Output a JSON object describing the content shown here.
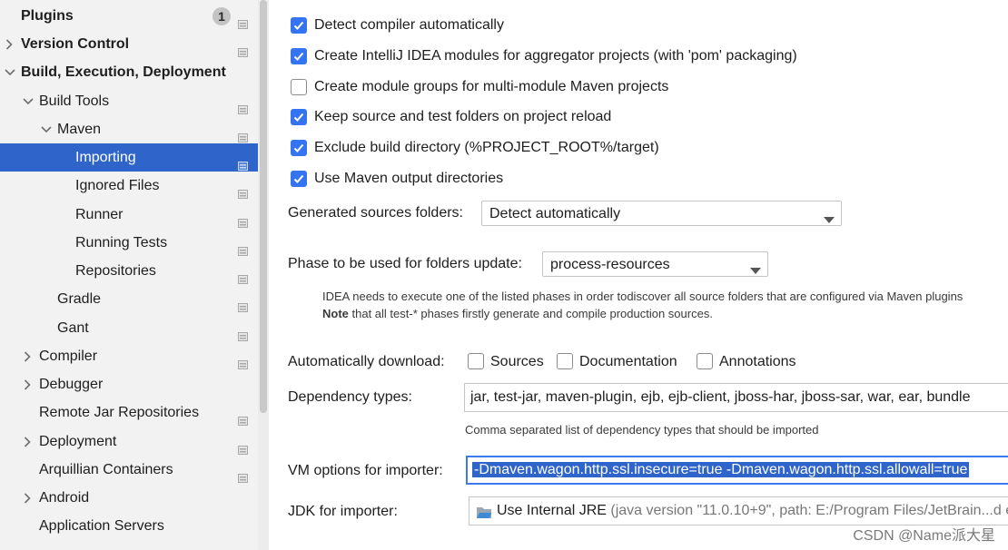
{
  "sidebar": {
    "items": [
      {
        "label": "Plugins",
        "badge": "1"
      },
      {
        "label": "Version Control"
      },
      {
        "label": "Build, Execution, Deployment"
      },
      {
        "label": "Build Tools"
      },
      {
        "label": "Maven"
      },
      {
        "label": "Importing"
      },
      {
        "label": "Ignored Files"
      },
      {
        "label": "Runner"
      },
      {
        "label": "Running Tests"
      },
      {
        "label": "Repositories"
      },
      {
        "label": "Gradle"
      },
      {
        "label": "Gant"
      },
      {
        "label": "Compiler"
      },
      {
        "label": "Debugger"
      },
      {
        "label": "Remote Jar Repositories"
      },
      {
        "label": "Deployment"
      },
      {
        "label": "Arquillian Containers"
      },
      {
        "label": "Android"
      },
      {
        "label": "Application Servers"
      }
    ]
  },
  "main": {
    "checkboxes": [
      {
        "label": "Detect compiler automatically",
        "checked": true
      },
      {
        "label": "Create IntelliJ IDEA modules for aggregator projects (with 'pom' packaging)",
        "checked": true
      },
      {
        "label": "Create module groups for multi-module Maven projects",
        "checked": false
      },
      {
        "label": "Keep source and test folders on project reload",
        "checked": true
      },
      {
        "label": "Exclude build directory (%PROJECT_ROOT%/target)",
        "checked": true
      },
      {
        "label": "Use Maven output directories",
        "checked": true
      }
    ],
    "generated_sources": {
      "label": "Generated sources folders:",
      "value": "Detect automatically"
    },
    "phase": {
      "label": "Phase to be used for folders update:",
      "value": "process-resources"
    },
    "phase_note": {
      "line1": "IDEA needs to execute one of the listed phases in order todiscover all source folders that are configured via Maven plugins",
      "note_bold": "Note",
      "line2_rest": " that all test-* phases firstly generate and compile production sources."
    },
    "auto_download": {
      "label": "Automatically download:",
      "options": [
        {
          "label": "Sources",
          "checked": false
        },
        {
          "label": "Documentation",
          "checked": false
        },
        {
          "label": "Annotations",
          "checked": false
        }
      ]
    },
    "dependency_types": {
      "label": "Dependency types:",
      "value": "jar, test-jar, maven-plugin, ejb, ejb-client, jboss-har, jboss-sar, war, ear, bundle",
      "hint": "Comma separated list of dependency types that should be imported"
    },
    "vm_options": {
      "label": "VM options for importer:",
      "value": "-Dmaven.wagon.http.ssl.insecure=true -Dmaven.wagon.http.ssl.allowall=true"
    },
    "jdk": {
      "label": "JDK for importer:",
      "value": "Use Internal JRE",
      "detail": " (java version \"11.0.10+9\", path: E:/Program Files/JetBrain...d e"
    }
  },
  "watermark": "CSDN @Name派大星",
  "colors": {
    "accent": "#3574f0",
    "selection": "#2f65ca",
    "sidebar_bg": "#f2f2f2"
  }
}
